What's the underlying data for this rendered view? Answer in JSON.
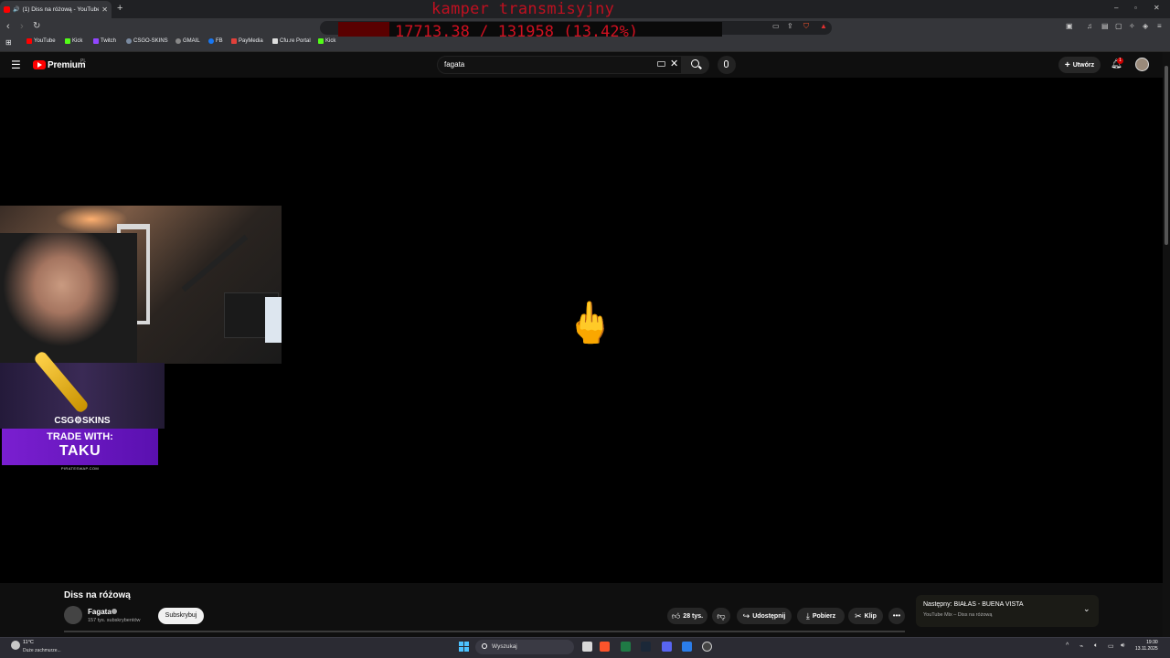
{
  "browser": {
    "tab_title": "(1) Diss na różową - YouTube",
    "new_tab": "+",
    "bookmarks": [
      "YouTube",
      "Kick",
      "Twitch",
      "CSGO-SKINS",
      "GMAIL",
      "FB",
      "PayMedia",
      "Cfu.re Portal",
      "Kick"
    ]
  },
  "stream_overlay": {
    "title": "kamper transmisyjny",
    "counter": "17713.38 / 131958 (13.42%)",
    "progress": 0.1342
  },
  "youtube": {
    "brand": "Premium",
    "region": "PL",
    "search_value": "fagata",
    "create_label": "Utwórz",
    "notification_count": "1"
  },
  "video": {
    "center_emoji": "🖕"
  },
  "sponsor": {
    "skins_logo": "CSG⚙SKINS",
    "trade_line1": "TRADE WITH:",
    "trade_line2": "TAKU",
    "trade_site": "PIRATESWAP.COM"
  },
  "below_video": {
    "title": "Diss na różową",
    "channel": "Fagata",
    "subscribers": "157 tys. subskrybentów",
    "subscribe_label": "Subskrybuj",
    "likes": "28 tys.",
    "share_label": "Udostępnij",
    "download_label": "Pobierz",
    "clip_label": "Klip",
    "next_label": "Następny: BIAŁAS - BUENA VISTA",
    "next_sub": "YouTube Mix – Diss na różową"
  },
  "taskbar": {
    "weather_temp": "11°C",
    "weather_desc": "Duże zachmurze...",
    "search_placeholder": "Wyszukaj",
    "time": "19:30",
    "date": "13.11.2025"
  },
  "colors": {
    "yt_red": "#ff0000",
    "overlay_red": "#c01020",
    "trade_purple": "#7a1fd0"
  }
}
